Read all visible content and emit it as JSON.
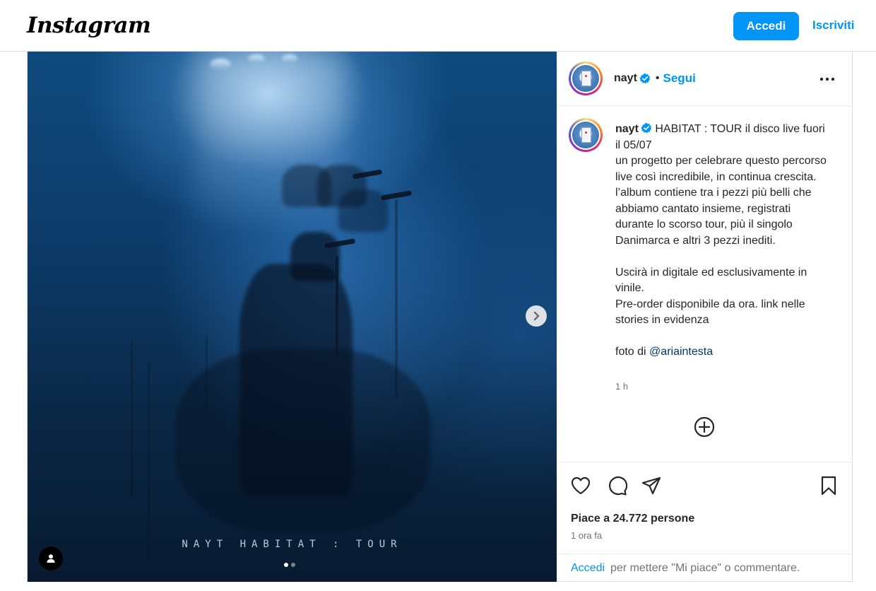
{
  "app": {
    "logo_text": "Instagram"
  },
  "header": {
    "login_label": "Accedi",
    "signup_label": "Iscriviti",
    "accent_color": "#0095f6"
  },
  "post": {
    "media": {
      "overlay_text": "NAYT HABITAT : TOUR",
      "slide_count": 2,
      "current_slide": 1,
      "icons": {
        "next": "chevron-right-icon",
        "user_tag": "user-icon"
      }
    },
    "author": {
      "username": "nayt",
      "verified": true,
      "follow_label": "Segui",
      "separator": "•"
    },
    "caption": {
      "username": "nayt",
      "lines": [
        "HABITAT : TOUR il disco live fuori il 05/07",
        "un progetto per celebrare questo percorso live così incredibile, in continua crescita. l’album contiene tra i pezzi più belli che abbiamo cantato insieme, registrati durante lo scorso tour, più il singolo Danimarca e altri 3 pezzi inediti."
      ],
      "lines2": [
        "Uscirà in digitale ed esclusivamente in vinile.",
        "Pre-order disponibile da ora. link nelle stories in evidenza"
      ],
      "credit_prefix": "foto di",
      "credit_mention": "@ariaintesta",
      "time": "1 h"
    },
    "actions": {
      "like_icon": "heart-icon",
      "comment_icon": "comment-icon",
      "share_icon": "send-icon",
      "save_icon": "bookmark-icon",
      "likes_text": "Piace a 24.772 persone",
      "time_ago": "1 ora fa"
    },
    "comment_bar": {
      "login_link": "Accedi",
      "rest_text": "per mettere \"Mi piace\" o commentare."
    }
  }
}
